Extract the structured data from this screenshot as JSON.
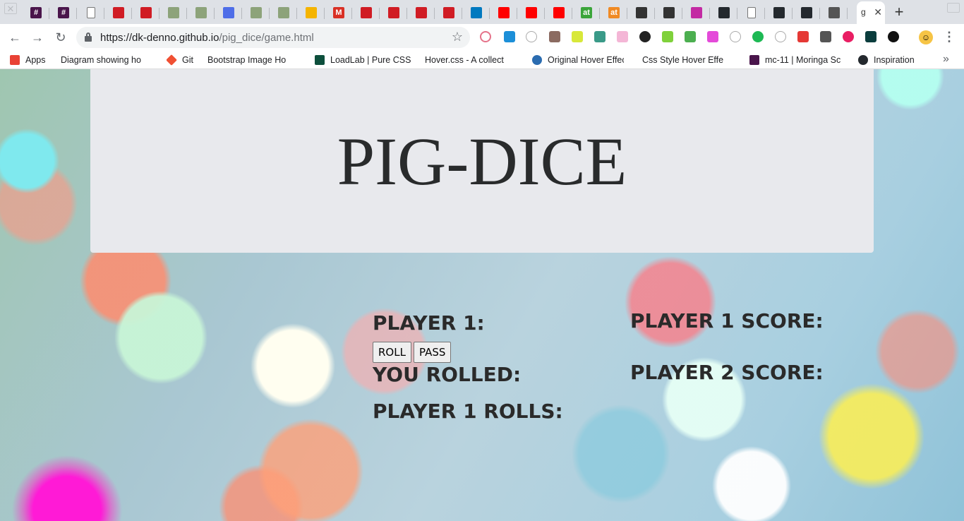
{
  "browser": {
    "active_tab_title": "g",
    "url_host": "https://dk-denno.github.io",
    "url_path": "/pig_dice/game.html",
    "tabs": [
      {
        "icon": "hash-icon",
        "label": "#",
        "color": "#4a154b"
      },
      {
        "icon": "hash-icon",
        "label": "#",
        "color": "#4a154b"
      },
      {
        "icon": "page-icon",
        "label": "",
        "color": "#ffffff"
      },
      {
        "icon": "flag-icon",
        "label": "",
        "color": "#d01c24"
      },
      {
        "icon": "flag-icon",
        "label": "",
        "color": "#d01c24"
      },
      {
        "icon": "tree-icon",
        "label": "",
        "color": "#8da37a"
      },
      {
        "icon": "tree-icon",
        "label": "",
        "color": "#8da37a"
      },
      {
        "icon": "docs-icon",
        "label": "",
        "color": "#4f6ee8"
      },
      {
        "icon": "tree-icon",
        "label": "",
        "color": "#8da37a"
      },
      {
        "icon": "tree-icon",
        "label": "",
        "color": "#8da37a"
      },
      {
        "icon": "bulb-icon",
        "label": "",
        "color": "#f5b400"
      },
      {
        "icon": "gmail-icon",
        "label": "M",
        "color": "#d93025"
      },
      {
        "icon": "flag-icon",
        "label": "",
        "color": "#d01c24"
      },
      {
        "icon": "flag-icon",
        "label": "",
        "color": "#d01c24"
      },
      {
        "icon": "flag-icon",
        "label": "",
        "color": "#d01c24"
      },
      {
        "icon": "flag-icon",
        "label": "",
        "color": "#d01c24"
      },
      {
        "icon": "trello-icon",
        "label": "",
        "color": "#0079bf"
      },
      {
        "icon": "youtube-icon",
        "label": "",
        "color": "#ff0000"
      },
      {
        "icon": "youtube-icon",
        "label": "",
        "color": "#ff0000"
      },
      {
        "icon": "youtube-icon",
        "label": "",
        "color": "#ff0000"
      },
      {
        "icon": "at-icon",
        "label": "at",
        "color": "#3ba53b"
      },
      {
        "icon": "at-icon",
        "label": "at",
        "color": "#f08a24"
      },
      {
        "icon": "codepen-icon",
        "label": "",
        "color": "#333333"
      },
      {
        "icon": "codepen-icon",
        "label": "",
        "color": "#333333"
      },
      {
        "icon": "instagram-icon",
        "label": "",
        "color": "#c32aa3"
      },
      {
        "icon": "github-icon",
        "label": "",
        "color": "#24292e"
      },
      {
        "icon": "page-icon",
        "label": "",
        "color": "#ffffff"
      },
      {
        "icon": "github-icon",
        "label": "",
        "color": "#24292e"
      },
      {
        "icon": "github-icon",
        "label": "",
        "color": "#24292e"
      },
      {
        "icon": "tool-icon",
        "label": "",
        "color": "#555555"
      }
    ],
    "bookmarks": [
      {
        "icon": "apps-grid-icon",
        "label": "Apps"
      },
      {
        "icon": "page-icon",
        "label": "Diagram showing ho"
      },
      {
        "icon": "git-icon",
        "label": "Git"
      },
      {
        "icon": "page-icon",
        "label": "Bootstrap Image Ho"
      },
      {
        "icon": "ef-icon",
        "label": "LoadLab | Pure CSS"
      },
      {
        "icon": "page-icon",
        "label": "Hover.css - A collect"
      },
      {
        "icon": "drop-icon",
        "label": "Original Hover Effec"
      },
      {
        "icon": "page-icon",
        "label": "Css Style Hover Effe"
      },
      {
        "icon": "hash-icon",
        "label": "mc-11 | Moringa Sc"
      },
      {
        "icon": "github-icon",
        "label": "Inspiration"
      }
    ]
  },
  "game": {
    "title": "PIG-DICE",
    "player_label": "PLAYER 1:",
    "roll_button": "ROLL",
    "pass_button": "PASS",
    "you_rolled_label": "YOU ROLLED:",
    "player_rolls_label": "PLAYER 1 ROLLS:",
    "player1_score_label": "PLAYER 1 SCORE:",
    "player2_score_label": "PLAYER 2 SCORE:"
  }
}
